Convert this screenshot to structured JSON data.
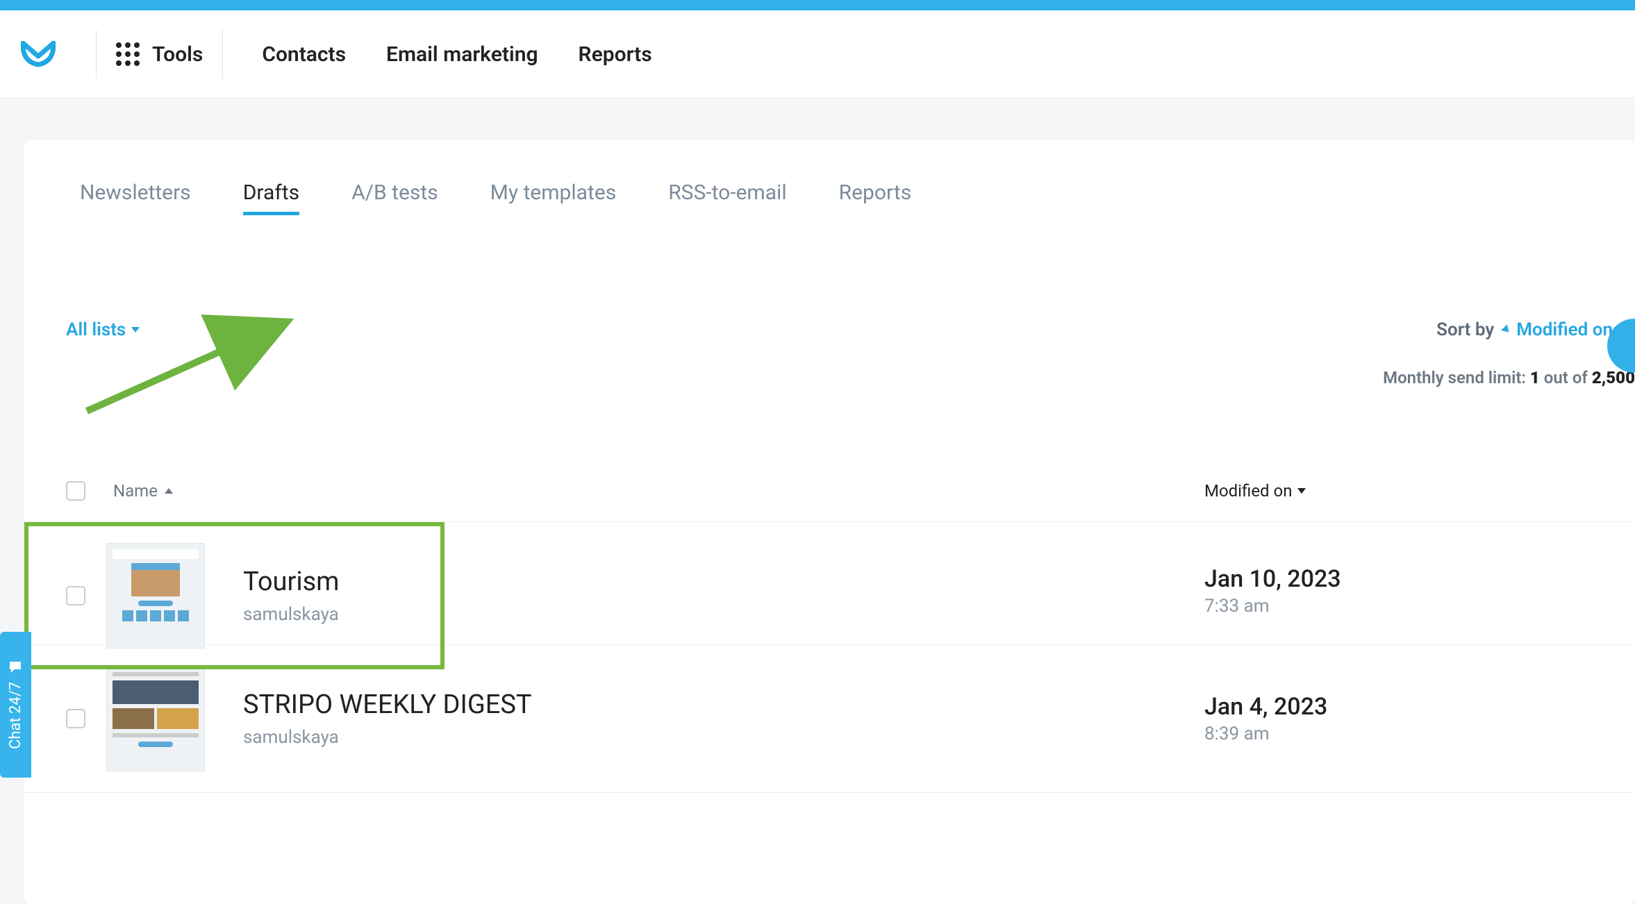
{
  "colors": {
    "accent": "#34b0e8",
    "highlight": "#76b83e"
  },
  "header": {
    "tools_label": "Tools",
    "nav": [
      "Contacts",
      "Email marketing",
      "Reports"
    ]
  },
  "tabs": [
    "Newsletters",
    "Drafts",
    "A/B tests",
    "My templates",
    "RSS-to-email",
    "Reports"
  ],
  "active_tab": "Drafts",
  "filters": {
    "list_dropdown": "All lists",
    "sort_label": "Sort by",
    "sort_value": "Modified on"
  },
  "limit": {
    "prefix": "Monthly send limit: ",
    "count": "1",
    "of_word": " out of ",
    "total": "2,500"
  },
  "columns": {
    "name": "Name",
    "modified": "Modified on"
  },
  "drafts": [
    {
      "name": "Tourism",
      "author": "samulskaya",
      "date": "Jan 10, 2023",
      "time": "7:33 am",
      "highlighted": true
    },
    {
      "name": "STRIPO WEEKLY DIGEST",
      "author": "samulskaya",
      "date": "Jan 4, 2023",
      "time": "8:39 am",
      "highlighted": false
    }
  ],
  "chat_label": "Chat 24/7"
}
